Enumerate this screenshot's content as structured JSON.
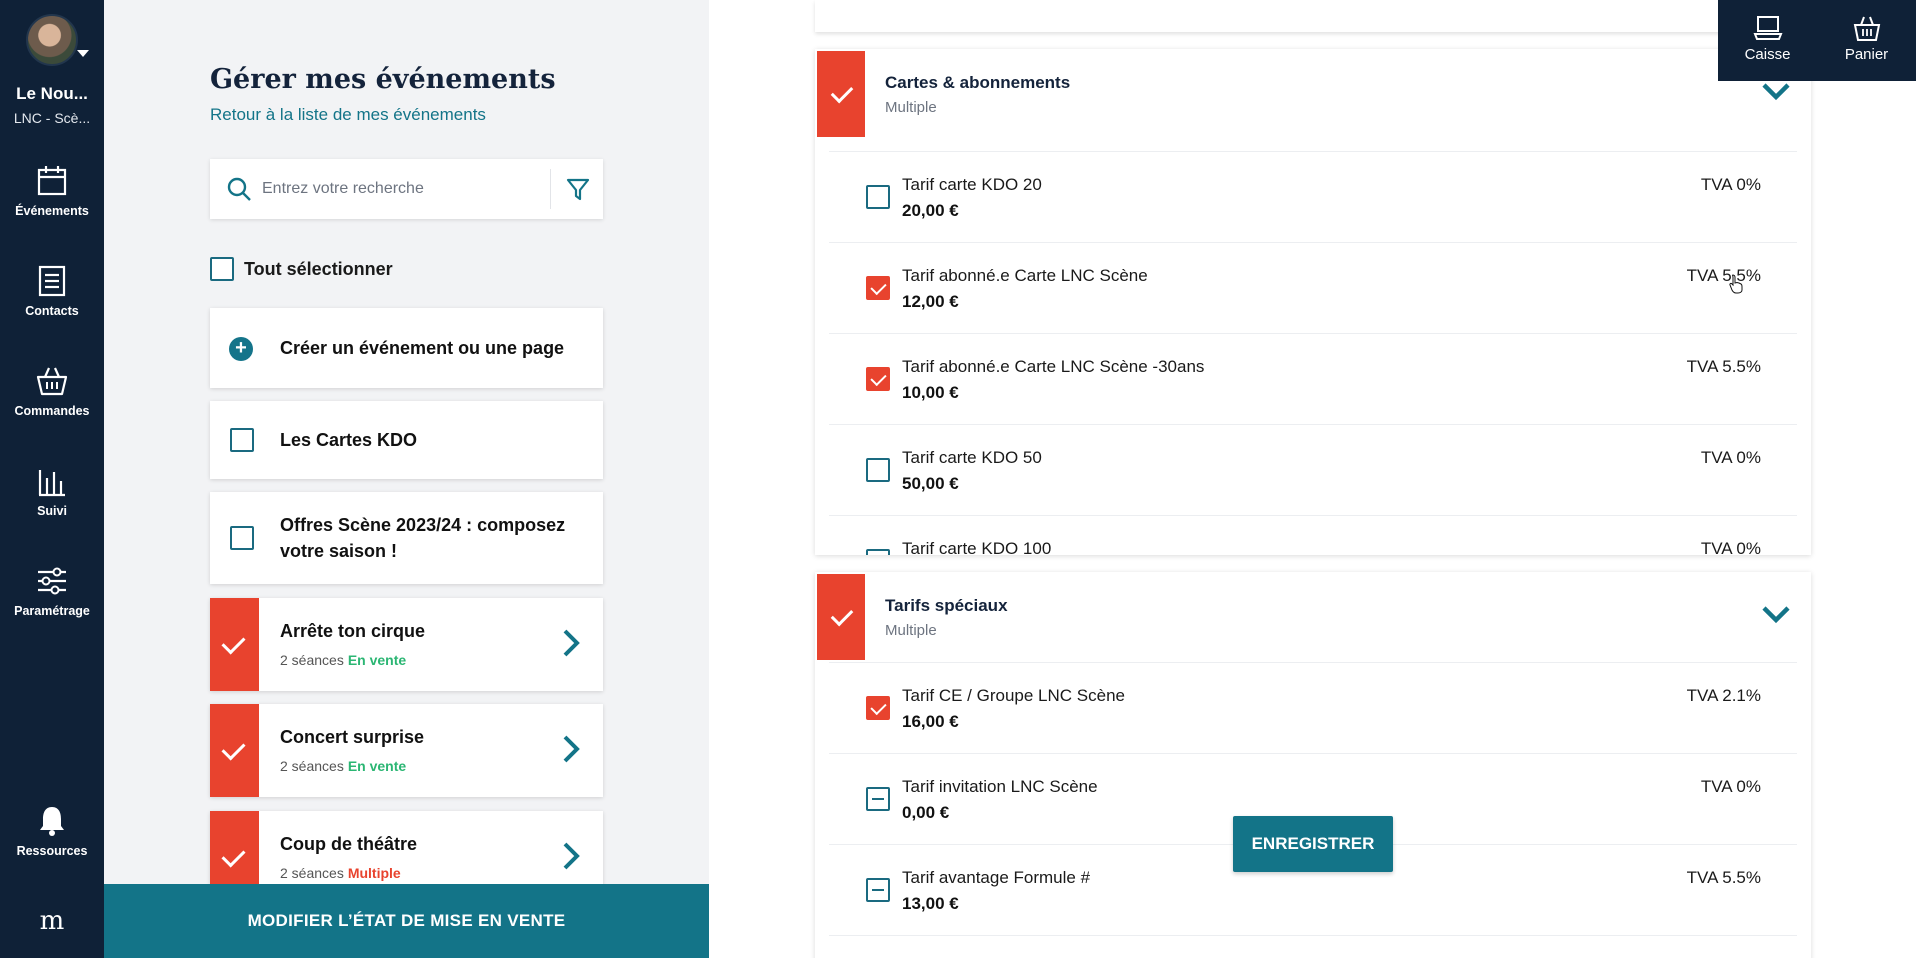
{
  "sidebar": {
    "org_name": "Le Nou...",
    "org_sub": "LNC - Scè...",
    "items": [
      {
        "label": "Événements",
        "icon": "calendar-icon"
      },
      {
        "label": "Contacts",
        "icon": "contacts-icon"
      },
      {
        "label": "Commandes",
        "icon": "basket-icon"
      },
      {
        "label": "Suivi",
        "icon": "chart-icon"
      },
      {
        "label": "Paramétrage",
        "icon": "sliders-icon"
      },
      {
        "label": "Ressources",
        "icon": "bell-icon"
      }
    ],
    "logo": "m"
  },
  "events_panel": {
    "title": "Gérer mes événements",
    "back_link": "Retour à la liste de mes événements",
    "search_placeholder": "Entrez votre recherche",
    "select_all": "Tout sélectionner",
    "create_label": "Créer un événement ou une page",
    "items": [
      {
        "title": "Les Cartes KDO",
        "checked": false
      },
      {
        "title_line1": "Offres Scène 2023/24 : composez",
        "title_line2": "votre saison !",
        "checked": false
      },
      {
        "title": "Arrête ton cirque",
        "sessions": "2 séances",
        "status": "En vente",
        "status_color": "#2bb673",
        "checked": true
      },
      {
        "title": "Concert surprise",
        "sessions": "2 séances",
        "status": "En vente",
        "status_color": "#2bb673",
        "checked": true
      },
      {
        "title": "Coup de théâtre",
        "sessions": "2 séances",
        "status": "Multiple",
        "status_color": "#e8432e",
        "checked": true
      }
    ],
    "bottom_button": "MODIFIER L’ÉTAT DE MISE EN VENTE"
  },
  "tarif_groups": [
    {
      "title": "Cartes & abonnements",
      "subtitle": "Multiple",
      "tarifs": [
        {
          "name": "Tarif carte KDO 20",
          "price": "20,00 €",
          "tva": "TVA 0%",
          "state": "unchecked"
        },
        {
          "name": "Tarif abonné.e Carte LNC Scène",
          "price": "12,00 €",
          "tva": "TVA 5.5%",
          "state": "checked"
        },
        {
          "name": "Tarif abonné.e Carte LNC Scène -30ans",
          "price": "10,00 €",
          "tva": "TVA 5.5%",
          "state": "checked"
        },
        {
          "name": "Tarif carte KDO 50",
          "price": "50,00 €",
          "tva": "TVA 0%",
          "state": "unchecked"
        },
        {
          "name": "Tarif carte KDO 100",
          "price": "",
          "tva": "TVA 0%",
          "state": "unchecked"
        }
      ]
    },
    {
      "title": "Tarifs spéciaux",
      "subtitle": "Multiple",
      "tarifs": [
        {
          "name": "Tarif CE / Groupe LNC Scène",
          "price": "16,00 €",
          "tva": "TVA 2.1%",
          "state": "checked"
        },
        {
          "name": "Tarif invitation LNC Scène",
          "price": "0,00 €",
          "tva": "TVA 0%",
          "state": "partial"
        },
        {
          "name": "Tarif avantage Formule #",
          "price": "13,00 €",
          "tva": "TVA 5.5%",
          "state": "partial"
        }
      ]
    }
  ],
  "save_button": "ENREGISTRER",
  "topbar": {
    "caisse": "Caisse",
    "panier": "Panier"
  },
  "colors": {
    "nav_bg": "#0f2137",
    "accent_teal": "#137488",
    "checked_red": "#e8432e",
    "on_sale_green": "#2bb673"
  }
}
